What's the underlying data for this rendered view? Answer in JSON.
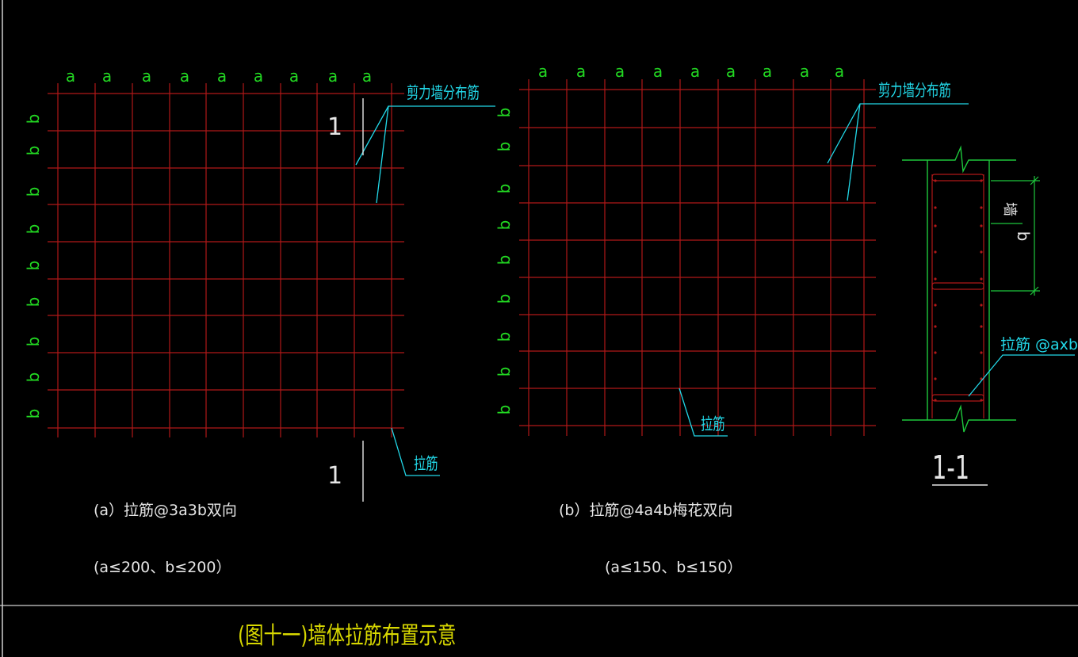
{
  "colors": {
    "background": "#000000",
    "grid": "#b01818",
    "label_green": "#22d822",
    "leader_cyan": "#22d8e8",
    "text_white": "#e6e6e6",
    "border": "#d0d0d0",
    "section_green": "#1ec83c",
    "title": "#d8d800"
  },
  "panel_a": {
    "col_labels": [
      "a",
      "a",
      "a",
      "a",
      "a",
      "a",
      "a",
      "a",
      "a"
    ],
    "row_labels": [
      "b",
      "b",
      "b",
      "b",
      "b",
      "b",
      "b",
      "b",
      "b"
    ],
    "leader_wall_label": "剪力墙分布筋",
    "leader_tie_label": "拉筋",
    "section_mark_top": "1",
    "section_mark_bottom": "1",
    "caption": "(a）拉筋@3a3b双向",
    "constraint": "(a≤200、b≤200）"
  },
  "panel_b": {
    "col_labels": [
      "a",
      "a",
      "a",
      "a",
      "a",
      "a",
      "a",
      "a",
      "a"
    ],
    "row_labels": [
      "b",
      "b",
      "b",
      "b",
      "b",
      "b",
      "b",
      "b",
      "b"
    ],
    "leader_wall_label": "剪力墙分布筋",
    "leader_tie_label": "拉筋",
    "caption": "(b）拉筋@4a4b梅花双向",
    "constraint": "(a≤150、b≤150）"
  },
  "section_view": {
    "wall_label": "墙",
    "dim_label": "b",
    "tie_label": "拉筋 @axb",
    "title": "1-1"
  },
  "figure_title": "(图十一)墙体拉筋布置示意"
}
